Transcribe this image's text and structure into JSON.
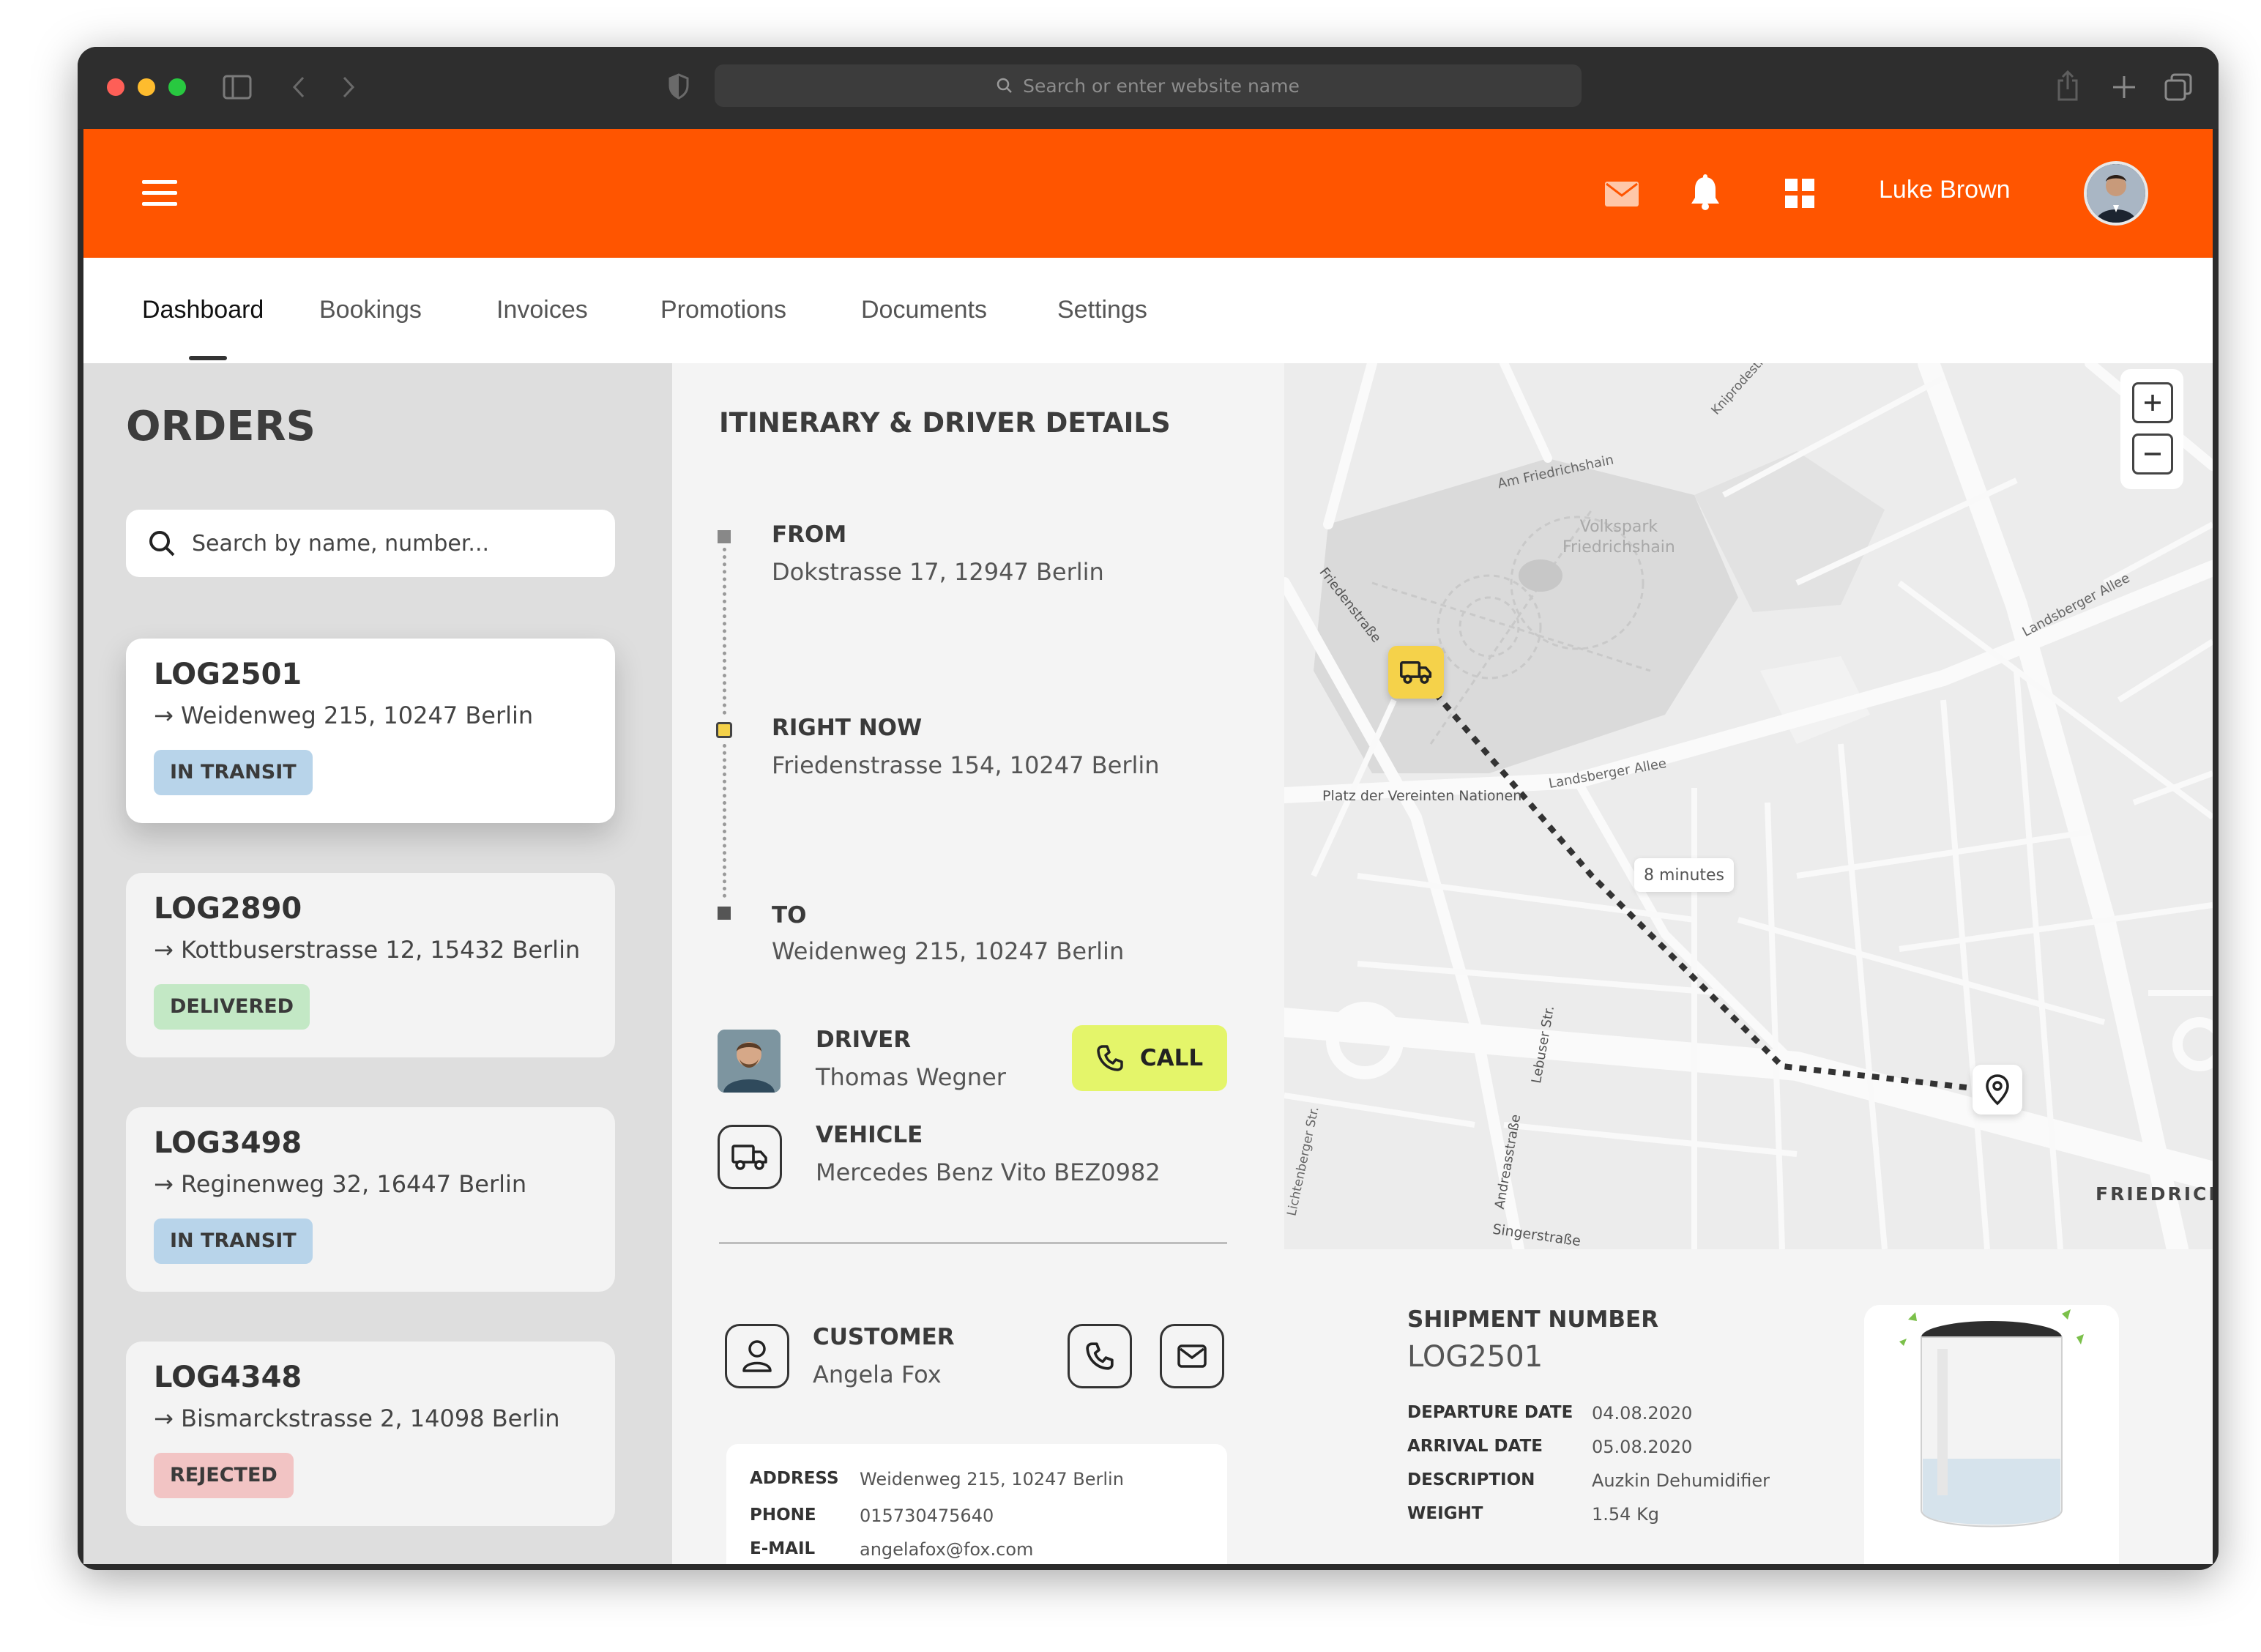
{
  "browser": {
    "url_placeholder": "Search or enter website name"
  },
  "topbar": {
    "user_name": "Luke Brown",
    "brand_color": "#ff5500"
  },
  "nav": {
    "tabs": [
      {
        "label": "Dashboard",
        "active": true
      },
      {
        "label": "Bookings"
      },
      {
        "label": "Invoices"
      },
      {
        "label": "Promotions"
      },
      {
        "label": "Documents"
      },
      {
        "label": "Settings"
      }
    ]
  },
  "orders": {
    "title": "ORDERS",
    "search_placeholder": "Search by name, number...",
    "items": [
      {
        "id": "LOG2501",
        "address": "Weidenweg 215, 10247 Berlin",
        "status": "IN TRANSIT",
        "status_color": "#b8d4ea"
      },
      {
        "id": "LOG2890",
        "address": "Kottbuserstrasse 12, 15432 Berlin",
        "status": "DELIVERED",
        "status_color": "#c3e8c5"
      },
      {
        "id": "LOG3498",
        "address": "Reginenweg 32, 16447 Berlin",
        "status": "IN TRANSIT",
        "status_color": "#b8d4ea"
      },
      {
        "id": "LOG4348",
        "address": "Bismarckstrasse 2, 14098 Berlin",
        "status": "REJECTED",
        "status_color": "#f2c4c4"
      }
    ]
  },
  "itinerary": {
    "title": "ITINERARY & DRIVER DETAILS",
    "from_label": "FROM",
    "from_value": "Dokstrasse 17, 12947 Berlin",
    "now_label": "RIGHT NOW",
    "now_value": "Friedenstrasse 154, 10247 Berlin",
    "to_label": "TO",
    "to_value": "Weidenweg 215, 10247 Berlin",
    "driver_label": "DRIVER",
    "driver_name": "Thomas Wegner",
    "call_label": "CALL",
    "call_color": "#e4f56a",
    "vehicle_label": "VEHICLE",
    "vehicle_value": "Mercedes Benz Vito BEZ0982"
  },
  "customer": {
    "label": "CUSTOMER",
    "name": "Angela Fox",
    "address_label": "ADDRESS",
    "address": "Weidenweg 215, 10247 Berlin",
    "phone_label": "PHONE",
    "phone": "015730475640",
    "email_label": "E-MAIL",
    "email": "angelafox@fox.com"
  },
  "map": {
    "eta": "8 minutes",
    "labels": {
      "park": "Volkspark\nFriedrichshain",
      "street1": "Am Friedrichshain",
      "street2": "Landsberger Allee",
      "street3": "Platz der Vereinten Nationen",
      "street4": "Friedenstraße",
      "street5": "Singerstraße",
      "street6": "FRIEDRICH",
      "street7": "Lebuser Str.",
      "street8": "Andreasstraße",
      "street9": "Kniprodestr.",
      "street10": "Landsberger Allee",
      "street11": "Lichtenberger Str."
    }
  },
  "shipment": {
    "label": "SHIPMENT NUMBER",
    "number": "LOG2501",
    "departure_label": "DEPARTURE DATE",
    "departure": "04.08.2020",
    "arrival_label": "ARRIVAL DATE",
    "arrival": "05.08.2020",
    "description_label": "DESCRIPTION",
    "description": "Auzkin Dehumidifier",
    "weight_label": "WEIGHT",
    "weight": "1.54 Kg"
  }
}
